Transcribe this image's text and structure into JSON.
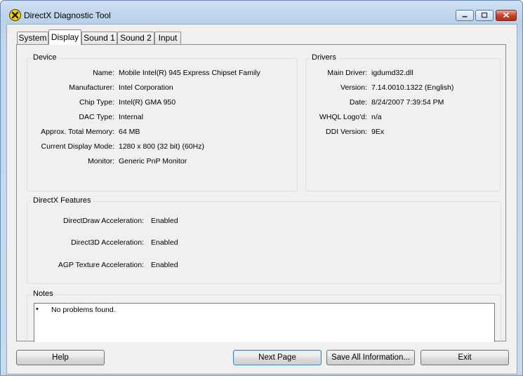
{
  "window": {
    "title": "DirectX Diagnostic Tool",
    "controls": {
      "minimize": "minimize",
      "maximize": "maximize",
      "close": "close"
    }
  },
  "tabs": [
    "System",
    "Display",
    "Sound 1",
    "Sound 2",
    "Input"
  ],
  "active_tab": "Display",
  "device": {
    "title": "Device",
    "rows": [
      {
        "label": "Name:",
        "value": "Mobile Intel(R) 945 Express Chipset Family"
      },
      {
        "label": "Manufacturer:",
        "value": "Intel Corporation"
      },
      {
        "label": "Chip Type:",
        "value": "Intel(R) GMA 950"
      },
      {
        "label": "DAC Type:",
        "value": "Internal"
      },
      {
        "label": "Approx. Total Memory:",
        "value": "64 MB"
      },
      {
        "label": "Current Display Mode:",
        "value": "1280 x 800 (32 bit) (60Hz)"
      },
      {
        "label": "Monitor:",
        "value": "Generic PnP Monitor"
      }
    ]
  },
  "drivers": {
    "title": "Drivers",
    "rows": [
      {
        "label": "Main Driver:",
        "value": "igdumd32.dll"
      },
      {
        "label": "Version:",
        "value": "7.14.0010.1322 (English)"
      },
      {
        "label": "Date:",
        "value": "8/24/2007 7:39:54 PM"
      },
      {
        "label": "WHQL Logo'd:",
        "value": "n/a"
      },
      {
        "label": "DDI Version:",
        "value": "9Ex"
      }
    ]
  },
  "features": {
    "title": "DirectX Features",
    "rows": [
      {
        "label": "DirectDraw Acceleration:",
        "value": "Enabled"
      },
      {
        "label": "Direct3D Acceleration:",
        "value": "Enabled"
      },
      {
        "label": "AGP Texture Acceleration:",
        "value": "Enabled"
      }
    ]
  },
  "notes": {
    "title": "Notes",
    "bullet": "•",
    "items": [
      "No problems found."
    ]
  },
  "buttons": {
    "help": "Help",
    "next_page": "Next Page",
    "save_all": "Save All Information...",
    "exit": "Exit"
  },
  "colors": {
    "title_gradient_top": "#cfe0f2",
    "close_button": "#c7422a",
    "panel_background": "#f0f0f0"
  }
}
